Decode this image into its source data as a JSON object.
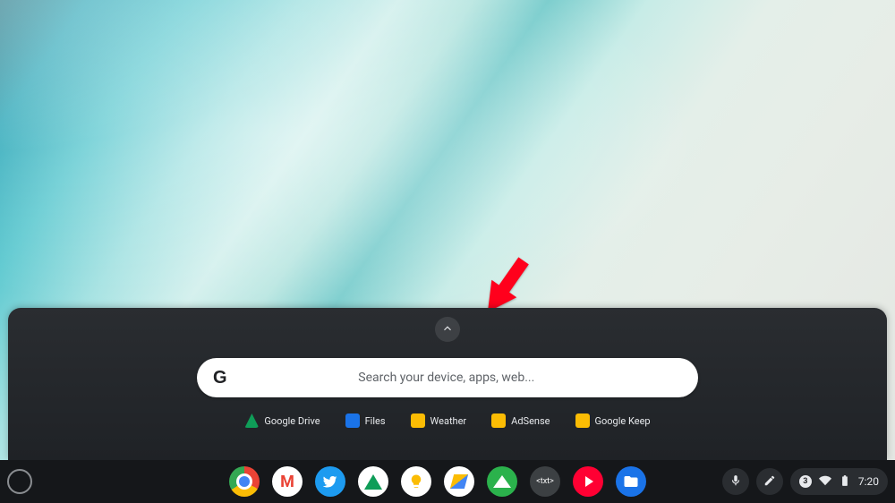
{
  "launcher": {
    "search_placeholder": "Search your device, apps, web...",
    "google_logo_text": "G",
    "suggestions": [
      {
        "label": "Google Drive"
      },
      {
        "label": "Files"
      },
      {
        "label": "Weather"
      },
      {
        "label": "AdSense"
      },
      {
        "label": "Google Keep"
      }
    ]
  },
  "shelf": {
    "apps": [
      {
        "name": "Chrome"
      },
      {
        "name": "Gmail"
      },
      {
        "name": "Twitter"
      },
      {
        "name": "Google Drive"
      },
      {
        "name": "Google Keep"
      },
      {
        "name": "AdSense"
      },
      {
        "name": "Feedly"
      },
      {
        "name": "Text",
        "glyph": "<txt>"
      },
      {
        "name": "YouTube Music"
      },
      {
        "name": "Files"
      }
    ]
  },
  "status": {
    "notification_count": "3",
    "clock": "7:20"
  },
  "annotation": {
    "points_to": "launcher-expand-button"
  }
}
